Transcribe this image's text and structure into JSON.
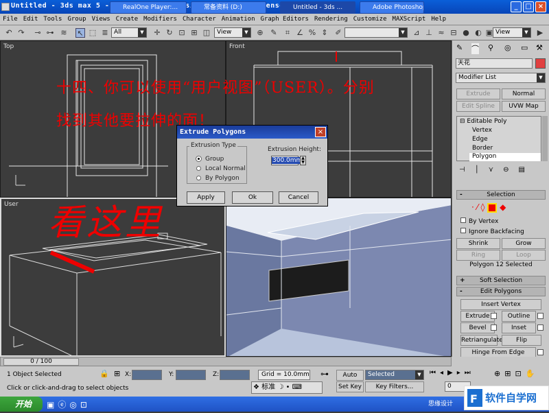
{
  "window": {
    "title": "Untitled - 3ds max 5 - Unregistered Version - Network License"
  },
  "menu": [
    "File",
    "Edit",
    "Tools",
    "Group",
    "Views",
    "Create",
    "Modifiers",
    "Character",
    "Animation",
    "Graph Editors",
    "Rendering",
    "Customize",
    "MAXScript",
    "Help"
  ],
  "toolbar": {
    "selection_filter": "All",
    "ref_coord": "View",
    "ref_coord2": "View"
  },
  "viewports": {
    "top": "Top",
    "front": "Front",
    "user": "User"
  },
  "annotations": {
    "line1": "十四、你可以使用“用户视图”（USER）。分别",
    "line2": "找到其他要拉伸的面！",
    "look_here": "看这里"
  },
  "dialog": {
    "title": "Extrude Polygons",
    "type_label": "Extrusion Type",
    "options": [
      "Group",
      "Local Normal",
      "By Polygon"
    ],
    "selected_option": "Group",
    "height_label": "Extrusion Height:",
    "height_value": "300.0mm",
    "apply": "Apply",
    "ok": "Ok",
    "cancel": "Cancel"
  },
  "command_panel": {
    "object_name": "天花",
    "modifier_list": "Modifier List",
    "buttons": {
      "extrude": "Extrude",
      "normal": "Normal",
      "edit_spline": "Edit Spline",
      "uvw_map": "UVW Map"
    },
    "stack": [
      "Editable Poly",
      "Vertex",
      "Edge",
      "Border",
      "Polygon"
    ],
    "selection": {
      "title": "Selection",
      "by_vertex": "By Vertex",
      "ignore_backfacing": "Ignore Backfacing",
      "shrink": "Shrink",
      "grow": "Grow",
      "ring": "Ring",
      "loop": "Loop",
      "status": "Polygon 12 Selected"
    },
    "soft_selection": "Soft Selection",
    "edit_polygons": {
      "title": "Edit Polygons",
      "insert_vertex": "Insert Vertex",
      "extrude": "Extrude",
      "outline": "Outline",
      "bevel": "Bevel",
      "inset": "Inset",
      "retriangulate": "Retriangulate",
      "flip": "Flip",
      "hinge": "Hinge From Edge"
    }
  },
  "status": {
    "timeline": "0 / 100",
    "selected": "1 Object Selected",
    "prompt": "Click or click-and-drag to select objects",
    "x_label": "X:",
    "y_label": "Y:",
    "z_label": "Z:",
    "grid": "Grid = 10.0mm",
    "auto_key": "Auto Key",
    "set_key": "Set Key",
    "key_mode": "Selected",
    "key_filters": "Key Filters...",
    "frame": "0"
  },
  "ime": {
    "mode": "标准"
  },
  "taskbar": {
    "start": "开始",
    "tasks": [
      "RealOne Player:...",
      "常备资料 (D:)",
      "Untitled - 3ds ...",
      "Adobe Photoshop"
    ],
    "watermark": "思缘设计"
  },
  "colors": {
    "annotation": "#ee0000",
    "selected_poly": "#e00000",
    "titlebar": "#0a5fd8"
  }
}
